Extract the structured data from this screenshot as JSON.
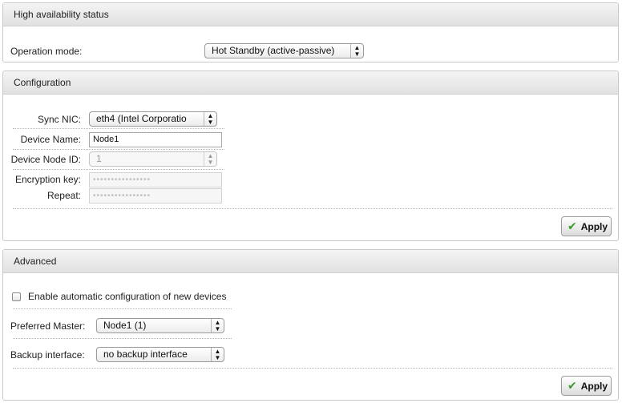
{
  "ha_status": {
    "title": "High availability status",
    "operation_mode_label": "Operation mode:",
    "operation_mode_value": "Hot Standby (active-passive)"
  },
  "configuration": {
    "title": "Configuration",
    "sync_nic_label": "Sync NIC:",
    "sync_nic_value": "eth4 (Intel Corporatio",
    "device_name_label": "Device Name:",
    "device_name_value": "Node1",
    "device_node_id_label": "Device Node ID:",
    "device_node_id_value": "1",
    "encryption_key_label": "Encryption key:",
    "encryption_key_value": "••••••••••••••••",
    "repeat_label": "Repeat:",
    "repeat_value": "••••••••••••••••",
    "apply_label": "Apply"
  },
  "advanced": {
    "title": "Advanced",
    "auto_config_label": "Enable automatic configuration of new devices",
    "preferred_master_label": "Preferred Master:",
    "preferred_master_value": "Node1 (1)",
    "backup_interface_label": "Backup interface:",
    "backup_interface_value": "no backup interface",
    "apply_label": "Apply"
  },
  "icons": {
    "select_arrows": "updown-arrows-icon",
    "apply": "checkmark-icon"
  },
  "colors": {
    "check_green": "#3a9a2a"
  }
}
